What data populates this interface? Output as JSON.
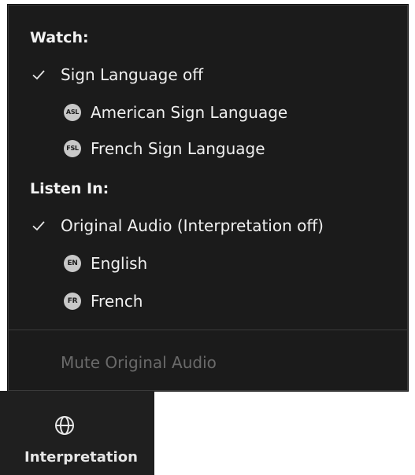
{
  "menu": {
    "watch": {
      "header": "Watch:",
      "items": [
        {
          "label": "Sign Language off",
          "checked": true,
          "badge": ""
        },
        {
          "label": "American Sign Language",
          "checked": false,
          "badge": "ASL"
        },
        {
          "label": "French Sign Language",
          "checked": false,
          "badge": "FSL"
        }
      ]
    },
    "listen": {
      "header": "Listen In:",
      "items": [
        {
          "label": "Original Audio (Interpretation off)",
          "checked": true,
          "badge": ""
        },
        {
          "label": "English",
          "checked": false,
          "badge": "EN"
        },
        {
          "label": "French",
          "checked": false,
          "badge": "FR"
        }
      ]
    },
    "mute_label": "Mute Original Audio"
  },
  "toolbar": {
    "interpretation_label": "Interpretation",
    "interpretation_icon": "globe-icon"
  },
  "colors": {
    "menu_bg": "#1b1b1b",
    "text": "#f0f0f0",
    "disabled_text": "#6a6a6a",
    "badge_bg": "#c8c8c8"
  }
}
